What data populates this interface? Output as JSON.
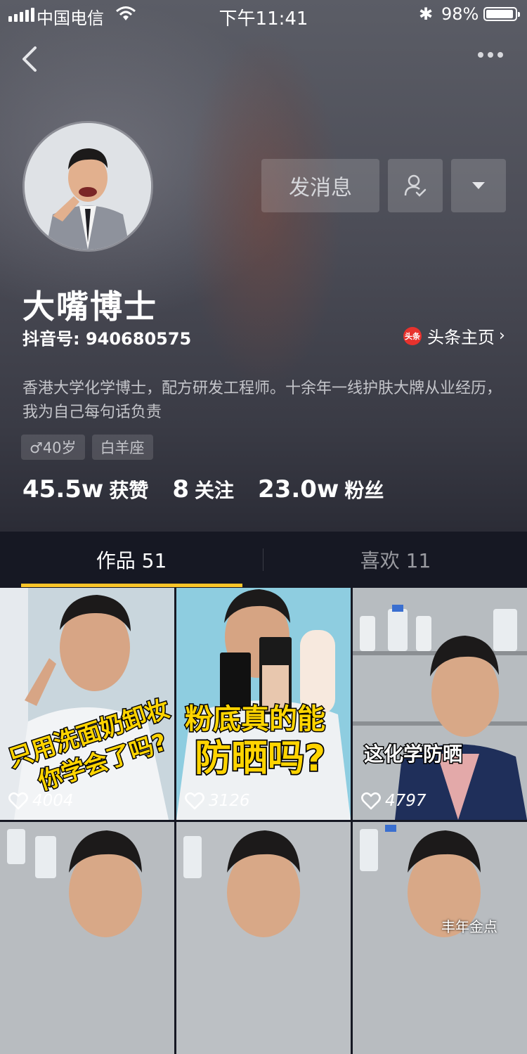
{
  "status_bar": {
    "carrier": "中国电信",
    "time": "下午11:41",
    "battery": "98%"
  },
  "profile": {
    "name": "大嘴博士",
    "douyin_id": "抖音号: 940680575",
    "toutiao_link": "头条主页",
    "toutiao_icon_text": "头条",
    "bio": "香港大学化学博士，配方研发工程师。十余年一线护肤大牌从业经历，我为自己每句话负责",
    "tags": [
      "♂40岁",
      "白羊座"
    ]
  },
  "actions": {
    "message": "发消息"
  },
  "stats": [
    {
      "num": "45.5w",
      "label": "获赞"
    },
    {
      "num": "8",
      "label": "关注"
    },
    {
      "num": "23.0w",
      "label": "粉丝"
    }
  ],
  "tabs": [
    {
      "label": "作品 51"
    },
    {
      "label": "喜欢 11"
    }
  ],
  "videos": [
    {
      "likes": "4004",
      "caption": [
        "只用洗面奶卸妆",
        "你学会了吗?"
      ]
    },
    {
      "likes": "3126",
      "caption": [
        "粉底真的能",
        "防晒吗?"
      ]
    },
    {
      "likes": "4797",
      "caption": [
        "这化学防晒"
      ]
    }
  ],
  "watermark": "丰年金点",
  "colors": {
    "accent": "#fbc529",
    "background": "#161823",
    "toutiao_red": "#e8322d"
  }
}
